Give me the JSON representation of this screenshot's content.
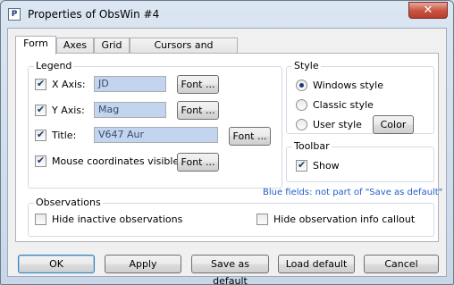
{
  "window": {
    "title": "Properties of ObsWin #4",
    "icon_letter": "P",
    "close_glyph": "✕"
  },
  "tabs": [
    {
      "label": "Form",
      "active": true
    },
    {
      "label": "Axes",
      "active": false
    },
    {
      "label": "Grid",
      "active": false
    },
    {
      "label": "Cursors and Indicators",
      "active": false
    }
  ],
  "legend": {
    "title": "Legend",
    "x_axis": {
      "label": "X Axis:",
      "value": "JD",
      "checked": true,
      "font_button": "Font ..."
    },
    "y_axis": {
      "label": "Y Axis:",
      "value": "Mag",
      "checked": true,
      "font_button": "Font ..."
    },
    "title_row": {
      "label": "Title:",
      "value": "V647 Aur",
      "checked": true,
      "font_button": "Font ..."
    },
    "mouse_coords": {
      "label": "Mouse coordinates visible",
      "checked": true,
      "font_button": "Font ..."
    }
  },
  "style": {
    "title": "Style",
    "windows": {
      "label": "Windows style",
      "selected": true
    },
    "classic": {
      "label": "Classic style",
      "selected": false
    },
    "user": {
      "label": "User style",
      "selected": false
    },
    "color_button": "Color"
  },
  "toolbar": {
    "title": "Toolbar",
    "show": {
      "label": "Show",
      "checked": true
    }
  },
  "note": "Blue fields: not part of \"Save as default\"",
  "observations": {
    "title": "Observations",
    "hide_inactive": {
      "label": "Hide inactive observations",
      "checked": false
    },
    "hide_callout": {
      "label": "Hide observation info callout",
      "checked": false
    }
  },
  "buttons": {
    "ok": "OK",
    "apply": "Apply",
    "save_default": "Save as default",
    "load_default": "Load default",
    "cancel": "Cancel"
  }
}
